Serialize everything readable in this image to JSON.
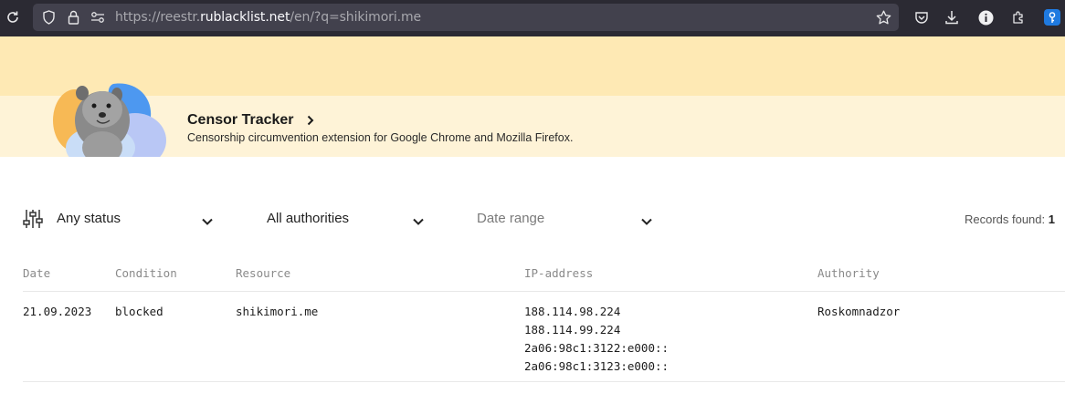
{
  "browser": {
    "url_prefix": "https://reestr.",
    "url_host": "rublacklist.net",
    "url_path": "/en/?q=shikimori.me"
  },
  "banner": {
    "title": "Censor Tracker",
    "subtitle": "Censorship circumvention extension for Google Chrome and Mozilla Firefox."
  },
  "filters": {
    "status": "Any status",
    "authorities": "All authorities",
    "date_range": "Date range",
    "records_label": "Records found:",
    "records_count": "1"
  },
  "table": {
    "headers": {
      "date": "Date",
      "condition": "Condition",
      "resource": "Resource",
      "ip": "IP-address",
      "authority": "Authority"
    },
    "rows": [
      {
        "date": "21.09.2023",
        "condition": "blocked",
        "resource": "shikimori.me",
        "ips": [
          "188.114.98.224",
          "188.114.99.224",
          "2a06:98c1:3122:e000::",
          "2a06:98c1:3123:e000::"
        ],
        "authority": "Roskomnadzor"
      }
    ]
  },
  "colors": {
    "toolbar_bg": "#2b2a33",
    "urlbar_bg": "#42414d",
    "banner_top": "#fee9b4",
    "banner_main": "#fef3d7"
  }
}
